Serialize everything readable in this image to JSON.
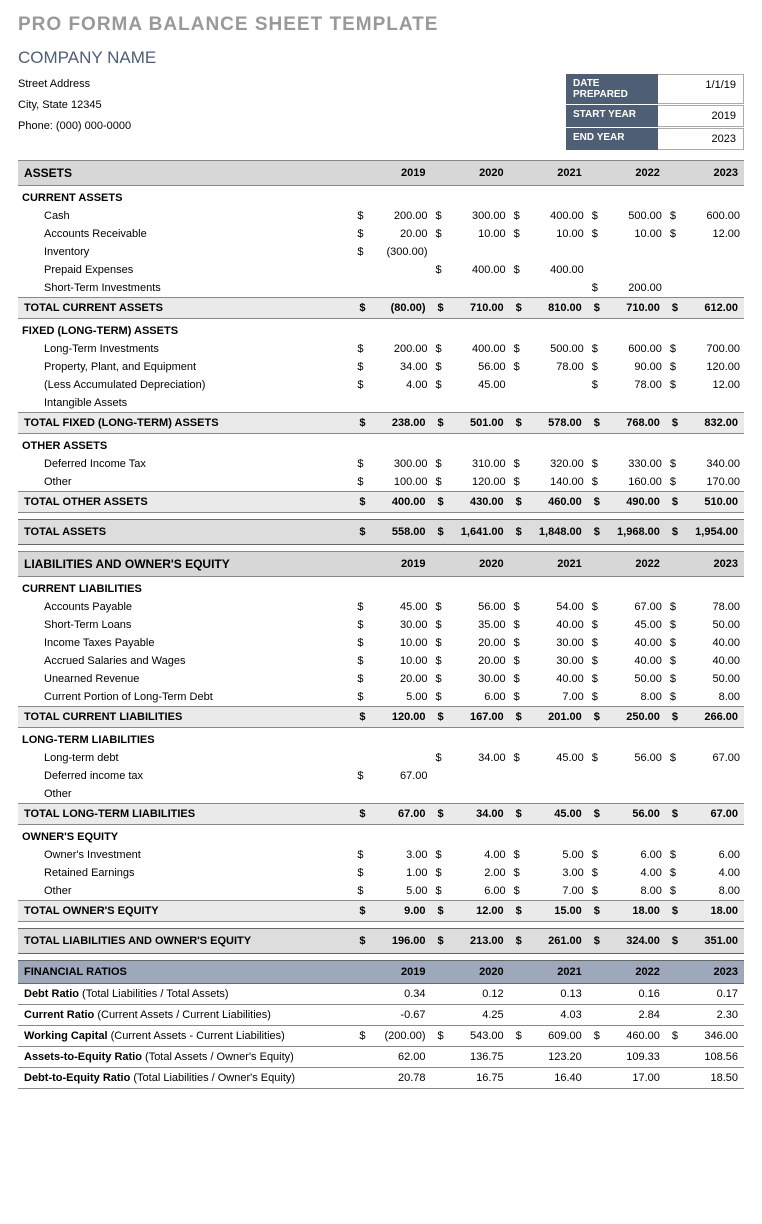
{
  "title": "PRO FORMA BALANCE SHEET TEMPLATE",
  "company": "COMPANY NAME",
  "addr": {
    "street": "Street Address",
    "city": "City, State  12345",
    "phone": "Phone: (000) 000-0000"
  },
  "meta": {
    "date_lbl": "DATE PREPARED",
    "date": "1/1/19",
    "start_lbl": "START YEAR",
    "start": "2019",
    "end_lbl": "END YEAR",
    "end": "2023"
  },
  "yrs": [
    "2019",
    "2020",
    "2021",
    "2022",
    "2023"
  ],
  "assets_lbl": "ASSETS",
  "ca": {
    "lbl": "CURRENT ASSETS",
    "rows": [
      {
        "lbl": "Cash",
        "v": [
          "200.00",
          "300.00",
          "400.00",
          "500.00",
          "600.00"
        ]
      },
      {
        "lbl": "Accounts Receivable",
        "v": [
          "20.00",
          "10.00",
          "10.00",
          "10.00",
          "12.00"
        ]
      },
      {
        "lbl": "Inventory",
        "v": [
          "(300.00)",
          "",
          "",
          "",
          ""
        ]
      },
      {
        "lbl": "Prepaid Expenses",
        "v": [
          "",
          "400.00",
          "400.00",
          "",
          ""
        ]
      },
      {
        "lbl": "Short-Term Investments",
        "v": [
          "",
          "",
          "",
          "200.00",
          ""
        ]
      }
    ],
    "tot": {
      "lbl": "TOTAL CURRENT ASSETS",
      "v": [
        "(80.00)",
        "710.00",
        "810.00",
        "710.00",
        "612.00"
      ]
    }
  },
  "fa": {
    "lbl": "FIXED (LONG-TERM) ASSETS",
    "rows": [
      {
        "lbl": "Long-Term Investments",
        "v": [
          "200.00",
          "400.00",
          "500.00",
          "600.00",
          "700.00"
        ]
      },
      {
        "lbl": "Property, Plant, and Equipment",
        "v": [
          "34.00",
          "56.00",
          "78.00",
          "90.00",
          "120.00"
        ]
      },
      {
        "lbl": "(Less Accumulated Depreciation)",
        "v": [
          "4.00",
          "45.00",
          "",
          "78.00",
          "12.00"
        ]
      },
      {
        "lbl": "Intangible Assets",
        "v": [
          "",
          "",
          "",
          "",
          ""
        ]
      }
    ],
    "tot": {
      "lbl": "TOTAL FIXED (LONG-TERM) ASSETS",
      "v": [
        "238.00",
        "501.00",
        "578.00",
        "768.00",
        "832.00"
      ]
    }
  },
  "oa": {
    "lbl": "OTHER ASSETS",
    "rows": [
      {
        "lbl": "Deferred Income Tax",
        "v": [
          "300.00",
          "310.00",
          "320.00",
          "330.00",
          "340.00"
        ]
      },
      {
        "lbl": "Other",
        "v": [
          "100.00",
          "120.00",
          "140.00",
          "160.00",
          "170.00"
        ]
      }
    ],
    "tot": {
      "lbl": "TOTAL OTHER ASSETS",
      "v": [
        "400.00",
        "430.00",
        "460.00",
        "490.00",
        "510.00"
      ]
    }
  },
  "ta": {
    "lbl": "TOTAL ASSETS",
    "v": [
      "558.00",
      "1,641.00",
      "1,848.00",
      "1,968.00",
      "1,954.00"
    ]
  },
  "liab_lbl": "LIABILITIES AND OWNER'S EQUITY",
  "cl": {
    "lbl": "CURRENT LIABILITIES",
    "rows": [
      {
        "lbl": "Accounts Payable",
        "v": [
          "45.00",
          "56.00",
          "54.00",
          "67.00",
          "78.00"
        ]
      },
      {
        "lbl": "Short-Term Loans",
        "v": [
          "30.00",
          "35.00",
          "40.00",
          "45.00",
          "50.00"
        ]
      },
      {
        "lbl": "Income Taxes Payable",
        "v": [
          "10.00",
          "20.00",
          "30.00",
          "40.00",
          "40.00"
        ]
      },
      {
        "lbl": "Accrued Salaries and Wages",
        "v": [
          "10.00",
          "20.00",
          "30.00",
          "40.00",
          "40.00"
        ]
      },
      {
        "lbl": "Unearned Revenue",
        "v": [
          "20.00",
          "30.00",
          "40.00",
          "50.00",
          "50.00"
        ]
      },
      {
        "lbl": "Current Portion of Long-Term Debt",
        "v": [
          "5.00",
          "6.00",
          "7.00",
          "8.00",
          "8.00"
        ]
      }
    ],
    "tot": {
      "lbl": "TOTAL CURRENT LIABILITIES",
      "v": [
        "120.00",
        "167.00",
        "201.00",
        "250.00",
        "266.00"
      ]
    }
  },
  "lt": {
    "lbl": "LONG-TERM LIABILITIES",
    "rows": [
      {
        "lbl": "Long-term debt",
        "v": [
          "",
          "34.00",
          "45.00",
          "56.00",
          "67.00"
        ]
      },
      {
        "lbl": "Deferred income tax",
        "v": [
          "67.00",
          "",
          "",
          "",
          ""
        ]
      },
      {
        "lbl": "Other",
        "v": [
          "",
          "",
          "",
          "",
          ""
        ]
      }
    ],
    "tot": {
      "lbl": "TOTAL LONG-TERM LIABILITIES",
      "v": [
        "67.00",
        "34.00",
        "45.00",
        "56.00",
        "67.00"
      ]
    }
  },
  "oe": {
    "lbl": "OWNER'S EQUITY",
    "rows": [
      {
        "lbl": "Owner's Investment",
        "v": [
          "3.00",
          "4.00",
          "5.00",
          "6.00",
          "6.00"
        ]
      },
      {
        "lbl": "Retained Earnings",
        "v": [
          "1.00",
          "2.00",
          "3.00",
          "4.00",
          "4.00"
        ]
      },
      {
        "lbl": "Other",
        "v": [
          "5.00",
          "6.00",
          "7.00",
          "8.00",
          "8.00"
        ]
      }
    ],
    "tot": {
      "lbl": "TOTAL OWNER'S EQUITY",
      "v": [
        "9.00",
        "12.00",
        "15.00",
        "18.00",
        "18.00"
      ]
    }
  },
  "tl": {
    "lbl": "TOTAL LIABILITIES AND OWNER'S EQUITY",
    "v": [
      "196.00",
      "213.00",
      "261.00",
      "324.00",
      "351.00"
    ]
  },
  "fr_lbl": "FINANCIAL RATIOS",
  "fr": [
    {
      "b": "Debt Ratio",
      "d": "(Total Liabilities / Total Assets)",
      "cur": false,
      "v": [
        "0.34",
        "0.12",
        "0.13",
        "0.16",
        "0.17"
      ]
    },
    {
      "b": "Current Ratio",
      "d": "(Current Assets / Current Liabilities)",
      "cur": false,
      "v": [
        "-0.67",
        "4.25",
        "4.03",
        "2.84",
        "2.30"
      ]
    },
    {
      "b": "Working Capital",
      "d": "(Current Assets - Current Liabilities)",
      "cur": true,
      "v": [
        "(200.00)",
        "543.00",
        "609.00",
        "460.00",
        "346.00"
      ]
    },
    {
      "b": "Assets-to-Equity Ratio",
      "d": "(Total Assets / Owner's Equity)",
      "cur": false,
      "v": [
        "62.00",
        "136.75",
        "123.20",
        "109.33",
        "108.56"
      ]
    },
    {
      "b": "Debt-to-Equity Ratio",
      "d": "(Total Liabilities / Owner's Equity)",
      "cur": false,
      "v": [
        "20.78",
        "16.75",
        "16.40",
        "17.00",
        "18.50"
      ]
    }
  ]
}
